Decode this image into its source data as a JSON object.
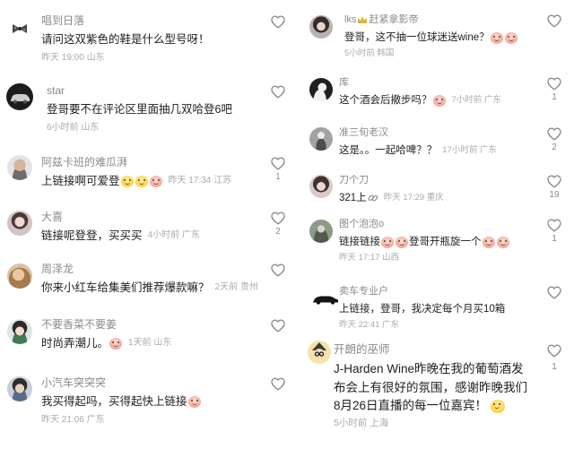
{
  "left": {
    "comments": [
      {
        "username": "唱到日落",
        "text": "请问这双紫色的鞋是什么型号呀！",
        "meta": "昨天 19:00 山东"
      },
      {
        "username": "star",
        "text": "登哥要不在评论区里面抽几双哈登6吧",
        "meta": "6小时前 山东"
      },
      {
        "username": "阿兹卡班的难瓜湃",
        "text": "上链接啊可爱登",
        "meta": "昨天 17:34 江苏",
        "likes": "1"
      },
      {
        "username": "大喜",
        "text": "链接呢登登，买买买",
        "meta": "4小时前 广东",
        "likes": "2"
      },
      {
        "username": "周泽龙",
        "text": "你来小红车给集美们推荐爆款嘛？",
        "meta": "2天前 贵州"
      },
      {
        "username": "不要香菜不要姜",
        "text": "时尚弄潮儿。",
        "meta": "1天前 山东"
      },
      {
        "username": "小汽车突突突",
        "text": "我买得起吗，买得起快上链接",
        "meta": "昨天 21:06 广东"
      }
    ]
  },
  "right": {
    "comments": [
      {
        "username_prefix": "lks",
        "username": "赶紧拿影帝",
        "text": "登哥，这不抽一位球迷送wine？",
        "meta": "5小时前 韩国"
      },
      {
        "username": "库",
        "text": "这个酒会后撤步吗？",
        "meta": "7小时前 广东",
        "likes": "1"
      },
      {
        "username": "准三旬老汉",
        "text": "这是。。一起哈啤？？",
        "meta": "17小时前 广东",
        "likes": "2"
      },
      {
        "username": "刀个刀",
        "text": "321上",
        "meta": "昨天 17:29 重庆",
        "likes": "19"
      },
      {
        "username": "图个泡泡o",
        "text_1": "链接链接",
        "text_2": "登哥开瓶旋一个",
        "meta": "昨天 17:17 山西",
        "likes": "1"
      },
      {
        "username": "卖车专业户",
        "text": "上链接，登哥，我决定每个月买10箱",
        "meta": "昨天 22:41 广东"
      },
      {
        "username": "开朗的巫师",
        "text_lines": [
          "J-Harden Wine昨晚在我的葡萄酒发",
          "布会上有很好的氛围，感谢昨晚我们",
          "8月26日直播的每一位嘉宾！"
        ],
        "meta": "5小时前 上海",
        "likes": "1"
      }
    ]
  },
  "icons": {
    "like": "heart-outline-icon",
    "emoji_pink": "pig-face-emoji-icon",
    "emoji_yellow": "smile-emoji-icon",
    "link": "link-icon",
    "crown": "crown-icon"
  },
  "colors": {
    "username": "#8a8a8a",
    "body_text": "#1e1e1e",
    "meta": "#ababab",
    "heart": "#8c8c8c"
  }
}
